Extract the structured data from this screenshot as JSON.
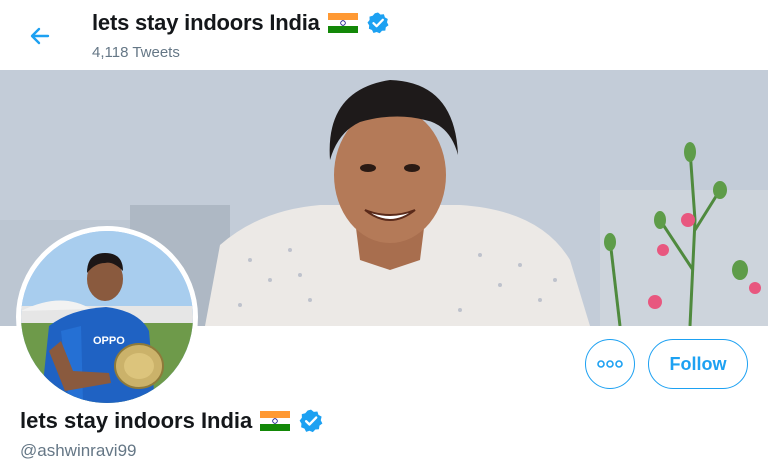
{
  "header": {
    "title": "lets stay indoors India",
    "tweet_count": "4,118 Tweets"
  },
  "profile": {
    "display_name": "lets stay indoors India",
    "handle": "@ashwinravi99",
    "verified": true,
    "flag": "india-flag-emoji",
    "avatar_jersey_text": "OPPO"
  },
  "actions": {
    "more_label": "More",
    "follow_label": "Follow"
  },
  "colors": {
    "accent": "#1da1f2",
    "secondary_text": "#657786",
    "primary_text": "#14171a"
  },
  "icons": {
    "back": "arrow-left-icon",
    "verified": "verified-badge-icon",
    "more": "more-dots-icon"
  }
}
